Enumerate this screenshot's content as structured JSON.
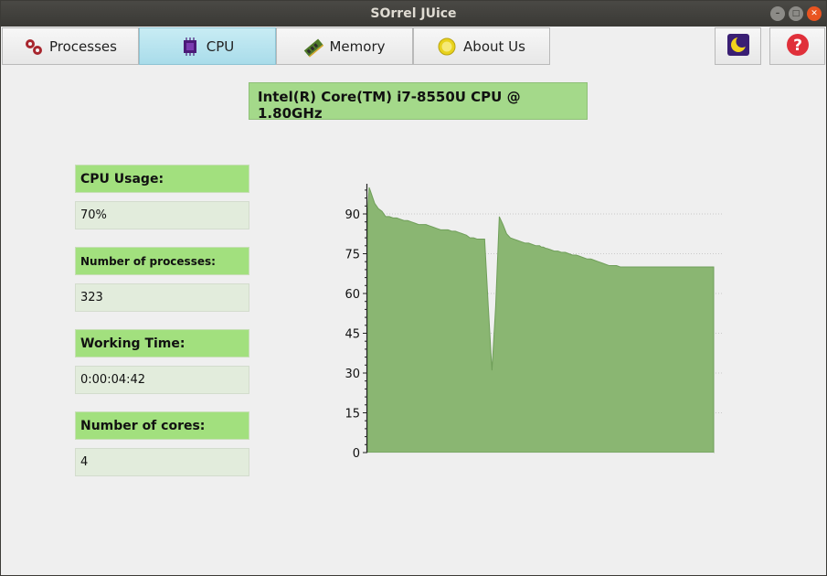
{
  "window": {
    "title": "SOrrel JUice"
  },
  "tabs": [
    {
      "label": "Processes",
      "icon": "gears-icon"
    },
    {
      "label": "CPU",
      "icon": "cpu-chip-icon"
    },
    {
      "label": "Memory",
      "icon": "memory-stick-icon"
    },
    {
      "label": "About Us",
      "icon": "lemon-icon"
    }
  ],
  "active_tab": "CPU",
  "toolbar": {
    "theme_icon": "moon-icon",
    "help_icon": "question-icon"
  },
  "cpu": {
    "model": "Intel(R) Core(TM) i7-8550U CPU @ 1.80GHz",
    "usage_label": "CPU Usage:",
    "usage_value": "70%",
    "processes_label": "Number of processes:",
    "processes_value": "323",
    "working_time_label": "Working Time:",
    "working_time_value": "0:00:04:42",
    "cores_label": "Number of cores:",
    "cores_value": "4"
  },
  "colors": {
    "accent": "#a2e07e",
    "chart_fill": "#8ab672",
    "chart_line": "#6f9e59",
    "active_tab": "#b3e1ec"
  },
  "chart_data": {
    "type": "area",
    "title": "",
    "xlabel": "",
    "ylabel": "",
    "ylim": [
      0,
      100
    ],
    "yticks": [
      0,
      15,
      30,
      45,
      60,
      75,
      90
    ],
    "grid": true,
    "x": [
      0,
      0.5,
      2,
      4,
      8,
      12,
      16,
      20,
      24,
      28,
      32,
      36,
      40,
      44,
      48,
      52,
      56,
      60,
      64,
      68,
      72,
      76,
      80,
      84,
      88,
      92,
      96,
      100,
      104,
      108,
      112,
      116,
      120,
      124,
      128,
      132,
      136,
      140,
      144,
      148,
      152,
      156,
      160,
      164,
      168,
      172,
      176,
      180,
      184,
      188,
      190,
      192,
      195,
      196,
      200,
      204,
      208,
      212,
      216,
      220,
      224,
      228,
      232,
      236,
      240,
      244,
      248,
      252,
      256,
      260,
      264,
      268,
      272,
      276,
      280,
      284,
      288,
      292,
      296,
      300,
      304,
      308,
      312,
      316,
      320,
      324,
      328,
      332,
      336,
      340,
      344,
      348,
      352,
      356,
      360,
      364,
      368,
      372,
      376,
      378
    ],
    "values": [
      77,
      92,
      100,
      98,
      94,
      92,
      91,
      89,
      89,
      88.5,
      88.5,
      88,
      87.5,
      87.5,
      87,
      86.5,
      86,
      86,
      86,
      85.5,
      85,
      84.5,
      84,
      84,
      84,
      83.5,
      83.5,
      83,
      82.5,
      82,
      81,
      81,
      80.5,
      80.5,
      80.5,
      55,
      31,
      55,
      89,
      86,
      82.5,
      81,
      80.5,
      80,
      79.5,
      79,
      79,
      78.5,
      78,
      78,
      77.5,
      77.5,
      77,
      77,
      76.5,
      76,
      76,
      75.5,
      75.5,
      75,
      74.5,
      74.5,
      74,
      73.5,
      73,
      73,
      72.5,
      72,
      71.5,
      71,
      70.5,
      70.5,
      70.5,
      70,
      70,
      70,
      70,
      70,
      70,
      70,
      70,
      70,
      70,
      70,
      70,
      70,
      70,
      70,
      70,
      70,
      70,
      70,
      70,
      70,
      70,
      70,
      70,
      70,
      70,
      70
    ]
  }
}
